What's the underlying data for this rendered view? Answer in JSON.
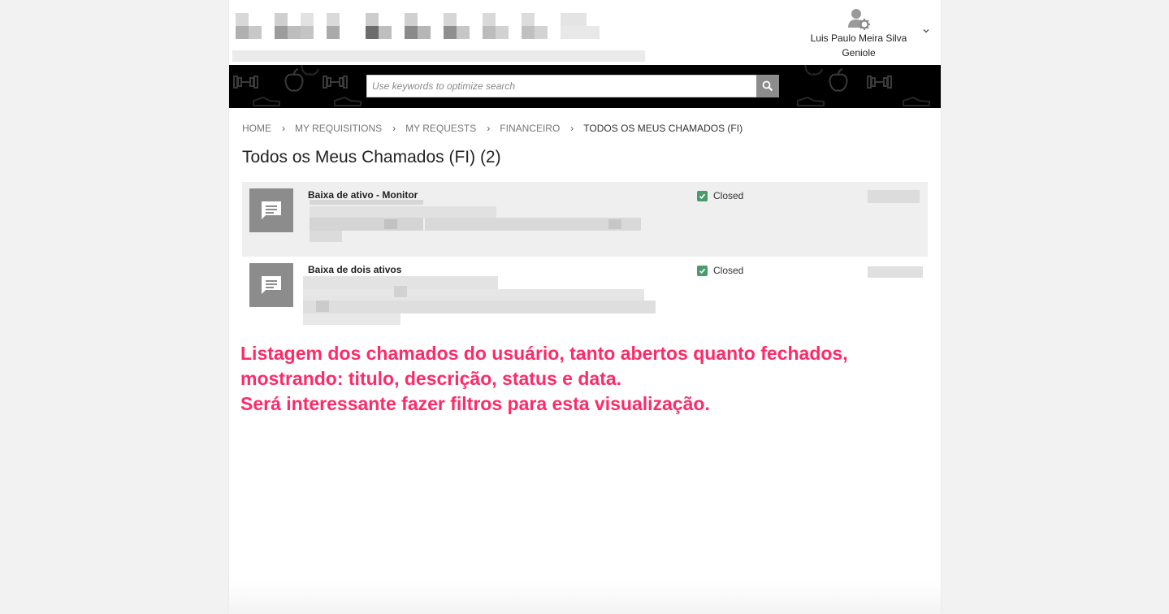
{
  "header": {
    "user_name_line1": "Luis Paulo Meira Silva",
    "user_name_line2": "Geniole",
    "user_icon": "user-settings-icon",
    "menu_icon": "chevron-down-icon"
  },
  "search": {
    "placeholder": "Use keywords to optimize search",
    "value": "",
    "button_icon": "search-icon"
  },
  "breadcrumb": {
    "items": [
      "HOME",
      "MY REQUISITIONS",
      "MY REQUESTS",
      "FINANCEIRO",
      "TODOS OS MEUS CHAMADOS (FI)"
    ]
  },
  "page_title": "Todos os Meus Chamados (FI) (2)",
  "requests": [
    {
      "title": "Baixa de ativo - Monitor",
      "status": "Closed",
      "icon": "comment-icon",
      "status_icon": "checkbox-checked-icon"
    },
    {
      "title": "Baixa de dois ativos",
      "status": "Closed",
      "icon": "comment-icon",
      "status_icon": "checkbox-checked-icon"
    }
  ],
  "annotation": {
    "line1": "Listagem dos chamados do usuário, tanto  abertos quanto fechados,",
    "line2": "mostrando: titulo, descrição, status e data.",
    "line3": "Será interessante fazer filtros para esta visualização."
  },
  "colors": {
    "annotation": "#ff2a68",
    "band": "#000000",
    "icon_bg": "#8c8c8c",
    "status_check": "#4a9a6a"
  }
}
